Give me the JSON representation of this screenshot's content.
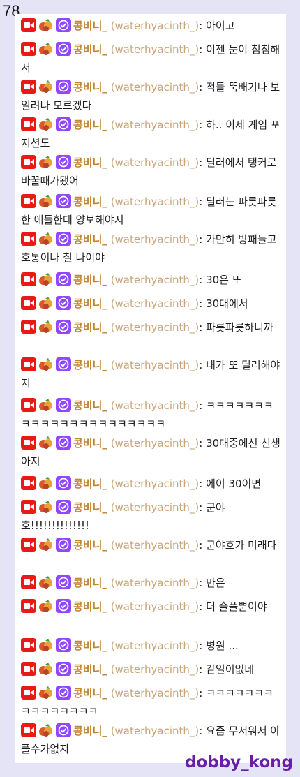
{
  "page_number": "78",
  "watermark": "dobby_kong",
  "user": {
    "display_name": "콩비니_",
    "login": "(waterhyacinth_)",
    "separator": ":"
  },
  "badges": [
    "video-camera-icon",
    "fruit-basket-icon",
    "check-badge-icon"
  ],
  "colors": {
    "background": "#e4e4f6",
    "panel": "#ffffff",
    "username": "#c08432",
    "login": "#c9a57a",
    "camera_badge": "#e91916",
    "check_badge": "#9147ff",
    "watermark": "#6a1ea8"
  },
  "messages": [
    {
      "text": "아이고"
    },
    {
      "text": "이젠 눈이 침침해서"
    },
    {
      "text": "적들 뚝배기나 보일려나 모르겠다"
    },
    {
      "text": "하.. 이제 게임 포지션도"
    },
    {
      "text": "딜러에서 탱커로 바꿀때가됐어"
    },
    {
      "text": "딜러는 파릇파릇한 애들한테 양보해야지"
    },
    {
      "text": "가만히 방패들고 호통이나 칠 나이야"
    },
    {
      "text": "30은 또"
    },
    {
      "text": "30대에서"
    },
    {
      "text": "파릇파릇하니까"
    },
    {
      "text": "내가 또 딜러해야지"
    },
    {
      "text": "ㅋㅋㅋㅋㅋㅋㅋㅋㅋㅋㅋㅋㅋㅋㅋㅋㅋㅋㅋㅋㅋㅋ"
    },
    {
      "text": "30대중에선 신생아지"
    },
    {
      "text": "에이 30이면"
    },
    {
      "text": "군야호!!!!!!!!!!!!!!"
    },
    {
      "text": "군야호가 미래다"
    },
    {
      "text": "만은"
    },
    {
      "text": "더 슬플뿐이야"
    },
    {
      "text": "병원 ..."
    },
    {
      "text": "같일이없네"
    },
    {
      "text": "ㅋㅋㅋㅋㅋㅋㅋㅋㅋㅋㅋㅋㅋㅋㅋ"
    },
    {
      "text": "요즘 무서워서 아플수가없지"
    }
  ]
}
